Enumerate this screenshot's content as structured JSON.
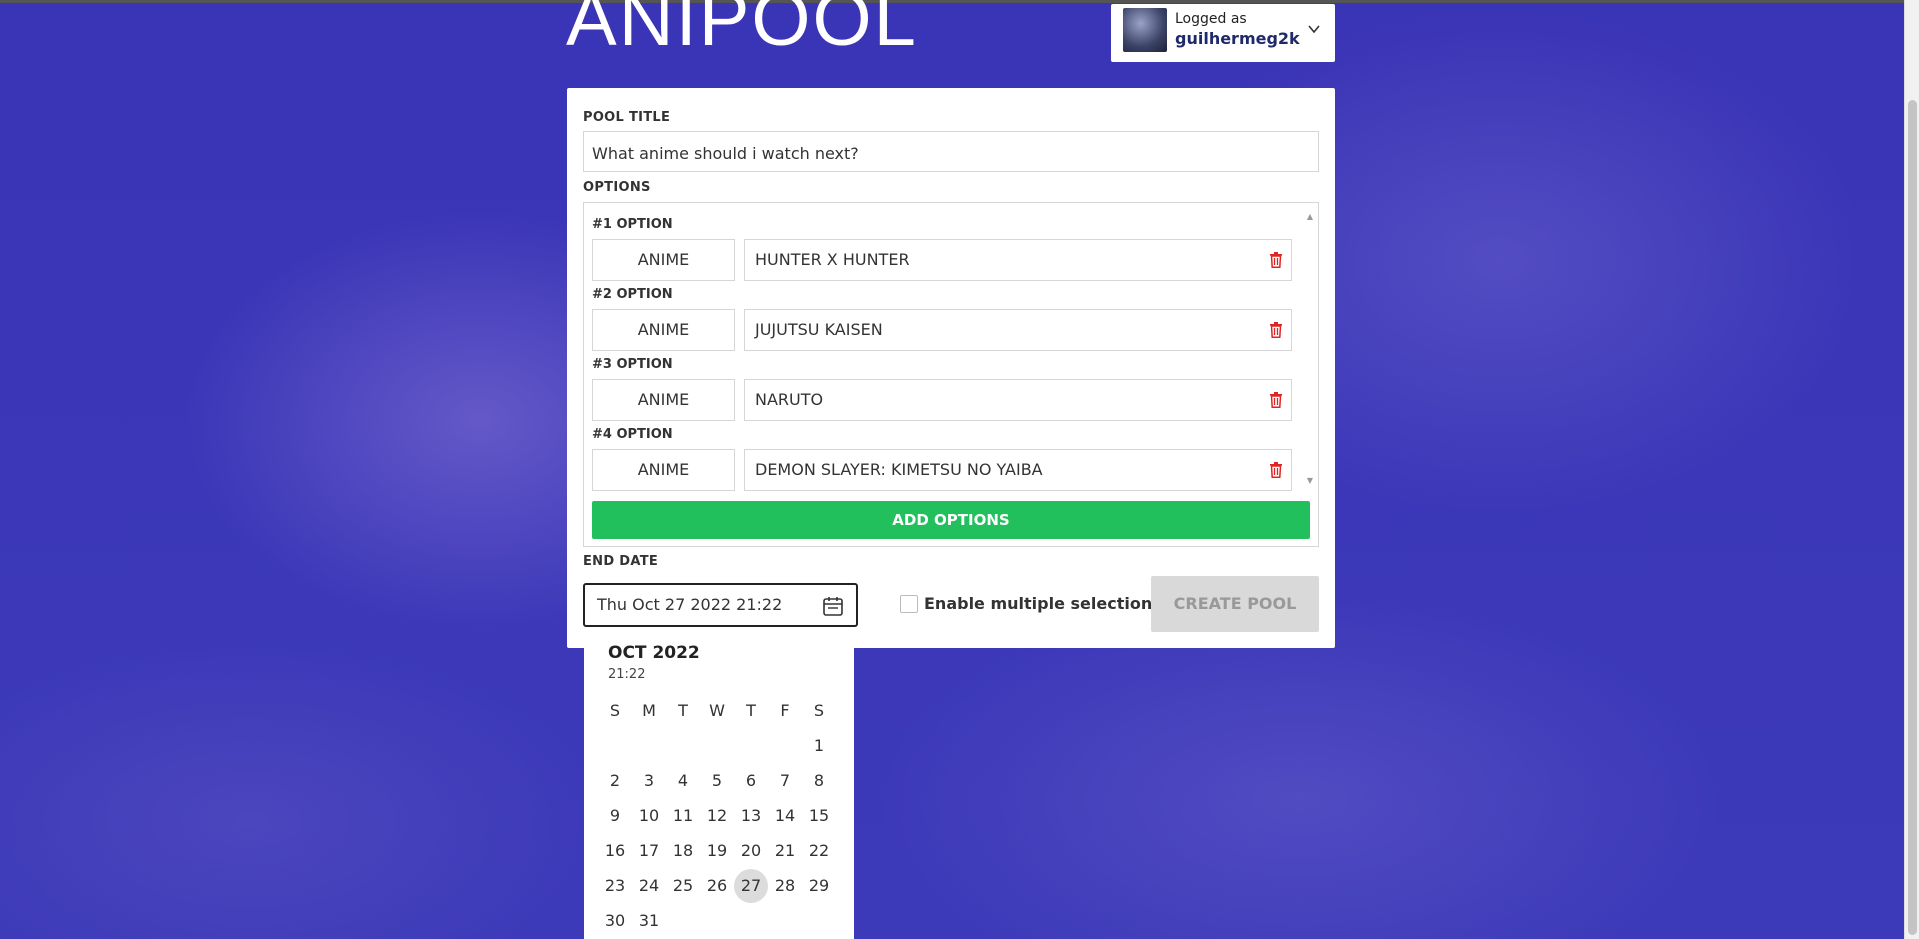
{
  "app": {
    "logo": "ANIPOOL"
  },
  "user": {
    "logged_as_label": "Logged as",
    "username": "guilhermeg2k"
  },
  "form": {
    "pool_title_label": "POOL TITLE",
    "pool_title_value": "What anime should i watch next?",
    "options_label": "OPTIONS",
    "options": [
      {
        "label": "#1 OPTION",
        "type": "ANIME",
        "name": "HUNTER X HUNTER"
      },
      {
        "label": "#2 OPTION",
        "type": "ANIME",
        "name": "JUJUTSU KAISEN"
      },
      {
        "label": "#3 OPTION",
        "type": "ANIME",
        "name": "NARUTO"
      },
      {
        "label": "#4 OPTION",
        "type": "ANIME",
        "name": "DEMON SLAYER: KIMETSU NO YAIBA"
      }
    ],
    "add_options_label": "ADD OPTIONS",
    "end_date_label": "END DATE",
    "end_date_value": "Thu Oct 27 2022 21:22",
    "multiple_selection_label": "Enable multiple selection",
    "multiple_selection_checked": false,
    "create_button_label": "CREATE POOL"
  },
  "calendar": {
    "month_label": "OCT 2022",
    "time": "21:22",
    "weekdays": [
      "S",
      "M",
      "T",
      "W",
      "T",
      "F",
      "S"
    ],
    "weeks": [
      [
        "",
        "",
        "",
        "",
        "",
        "",
        "1"
      ],
      [
        "2",
        "3",
        "4",
        "5",
        "6",
        "7",
        "8"
      ],
      [
        "9",
        "10",
        "11",
        "12",
        "13",
        "14",
        "15"
      ],
      [
        "16",
        "17",
        "18",
        "19",
        "20",
        "21",
        "22"
      ],
      [
        "23",
        "24",
        "25",
        "26",
        "27",
        "28",
        "29"
      ],
      [
        "30",
        "31",
        "",
        "",
        "",
        "",
        ""
      ]
    ],
    "selected_day": "27"
  },
  "colors": {
    "accent_green": "#21c05c",
    "background_blue": "#3b37b8",
    "trash_red": "#e02424"
  }
}
